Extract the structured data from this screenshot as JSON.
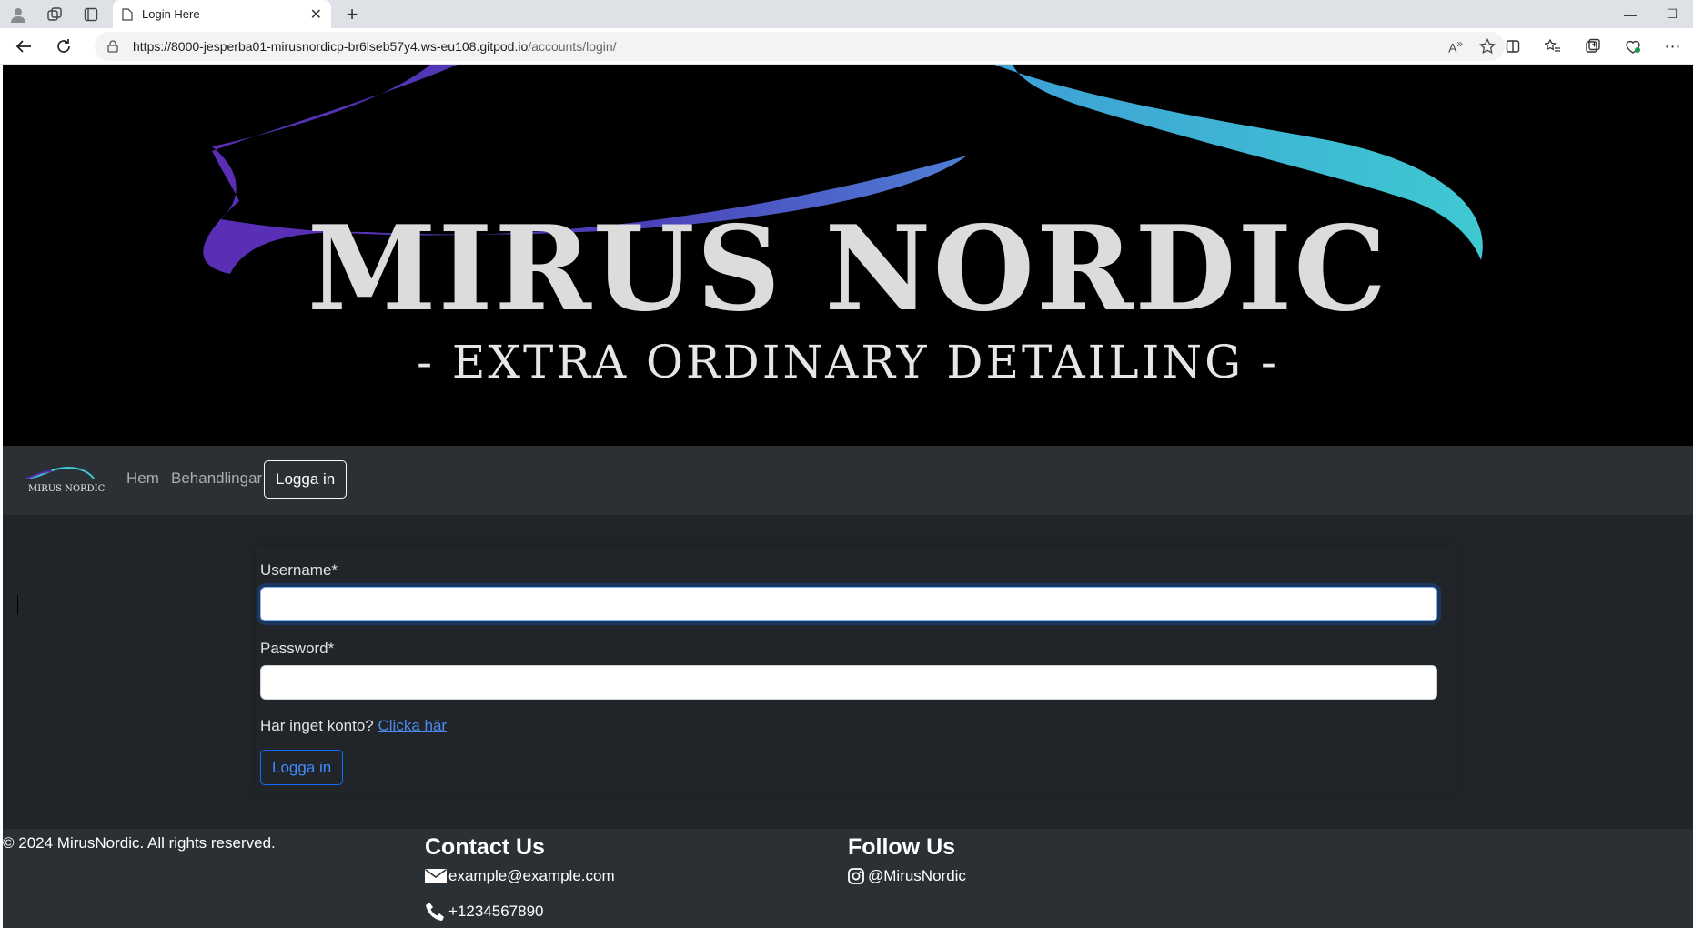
{
  "browser": {
    "tab_title": "Login Here",
    "url_host": "https://8000-jesperba01-mirusnordicp-br6lseb57y4.ws-eu108.gitpod.io",
    "url_path": "/accounts/login/"
  },
  "banner": {
    "brand": "MIRUS NORDIC",
    "tagline": "- EXTRA ORDINARY DETAILING -"
  },
  "navbar": {
    "logo_text": "MIRUS NORDIC",
    "links": [
      "Hem",
      "Behandlingar"
    ],
    "login_label": "Logga in"
  },
  "login_form": {
    "username_label": "Username*",
    "username_value": "",
    "password_label": "Password*",
    "password_value": "",
    "no_account_text": "Har inget konto?",
    "signup_link": "Clicka här",
    "submit_label": "Logga in"
  },
  "footer": {
    "copyright": "© 2024 MirusNordic. All rights reserved.",
    "contact_heading": "Contact Us",
    "email": "example@example.com",
    "phone": "+1234567890",
    "follow_heading": "Follow Us",
    "instagram": "@MirusNordic"
  },
  "colors": {
    "page_bg": "#212529",
    "navbar_bg": "#2b3035",
    "link_blue": "#4d8af0",
    "banner_purple": "#5a2db5",
    "banner_cyan": "#3fc9d2"
  }
}
